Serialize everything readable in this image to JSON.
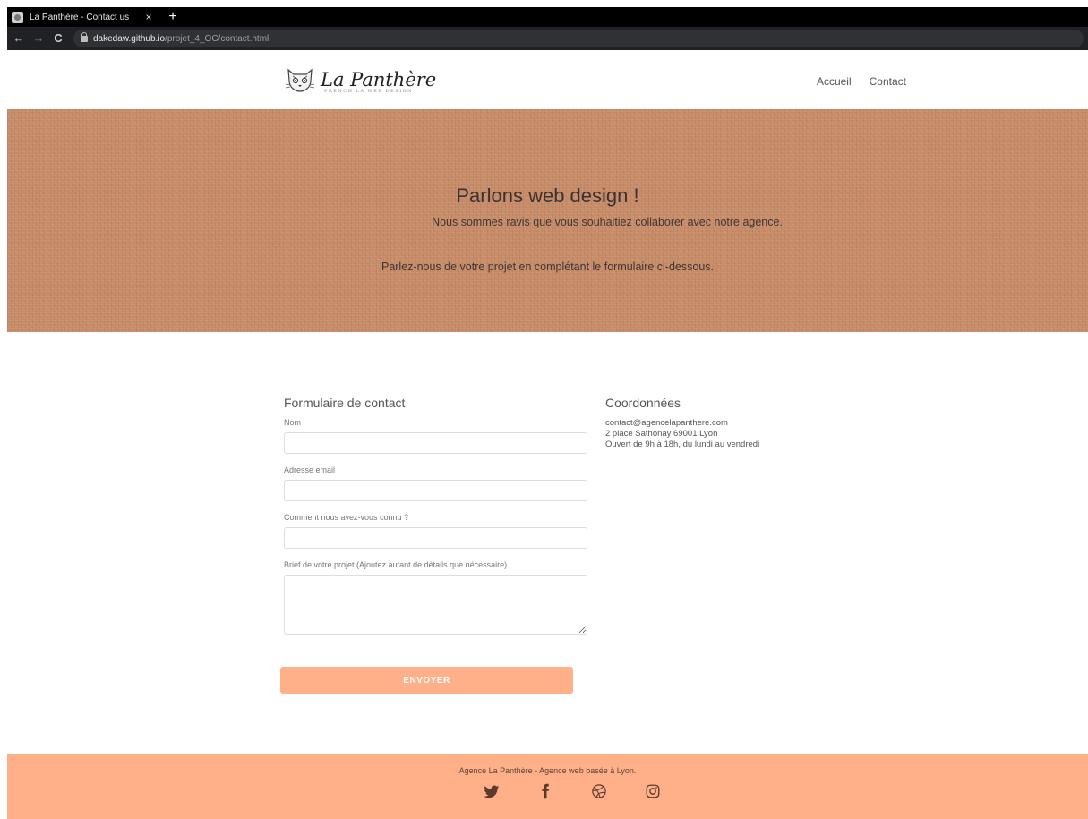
{
  "browser": {
    "tab_title": "La Panthère - Contact us",
    "tab_close": "×",
    "new_tab": "+",
    "url_host": "dakedaw.github.io",
    "url_path": "/projet_4_OC/contact.html",
    "back": "←",
    "forward": "→",
    "reload": "C"
  },
  "header": {
    "logo_text": "La Panthère",
    "logo_sub": "FRENCH LA WEB DESIGN",
    "nav": [
      {
        "label": "Accueil"
      },
      {
        "label": "Contact"
      }
    ]
  },
  "hero": {
    "title": "Parlons web design !",
    "line1": "Nous sommes ravis que vous souhaitiez collaborer avec notre agence.",
    "line2": "Parlez-nous de votre projet en complétant le formulaire ci-dessous."
  },
  "form": {
    "title": "Formulaire de contact",
    "fields": [
      {
        "label": "Nom",
        "value": ""
      },
      {
        "label": "Adresse email",
        "value": ""
      },
      {
        "label": "Comment nous avez-vous connu ?",
        "value": ""
      },
      {
        "label": "Brief de votre projet (Ajoutez autant de détails que nécessaire)",
        "value": ""
      }
    ],
    "submit_label": "ENVOYER"
  },
  "coords": {
    "title": "Coordonnées",
    "email": "contact@agencelapanthere.com",
    "address": "2 place Sathonay 69001 Lyon",
    "hours": "Ouvert de 9h à 18h, du lundi au vendredi"
  },
  "footer": {
    "text": "Agence La Panthère - Agence web basée à Lyon.",
    "social": [
      "twitter-icon",
      "facebook-icon",
      "dribbble-icon",
      "instagram-icon"
    ]
  },
  "colors": {
    "accent": "#ffb089",
    "hero_bg": "#c78a66"
  }
}
